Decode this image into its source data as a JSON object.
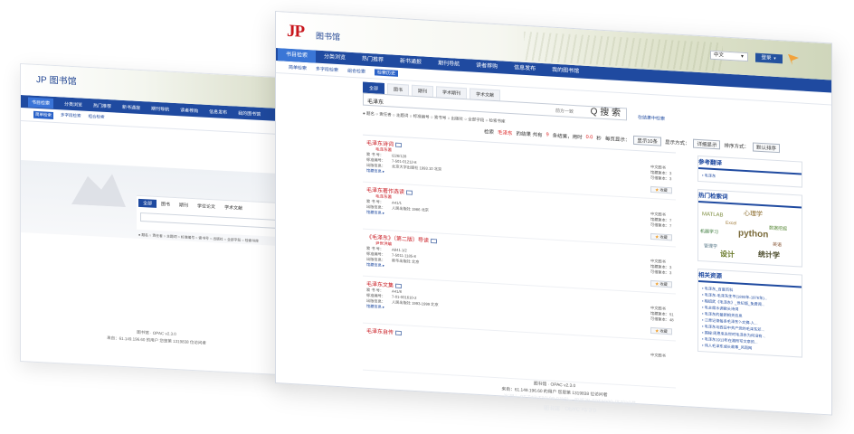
{
  "back_window": {
    "logo": "JP",
    "logo_text": "图书馆",
    "nav": [
      "书目检索",
      "分类浏览",
      "热门推荐",
      "新书通报",
      "期刊导航",
      "读者荐购",
      "信息发布",
      "我的图书馆"
    ],
    "subnav": [
      "简单检索",
      "多字段检索",
      "组合检索"
    ],
    "search_tabs": [
      "全部",
      "图书",
      "期刊",
      "学位论文",
      "学术文献"
    ],
    "options_line": "● 题名 ○ 责任者 ○ 主题词 ○ 标准编号 ○ 索书号 ○ 出版社 ○ 全部字段 ○ 检索书库",
    "footer_line1": "图书馆 · OPAC v2.3.0",
    "footer_line2": "来自：61.149.196.60 的用户 您是第 1319838 位访问者"
  },
  "front_window": {
    "logo": "JP",
    "logo_text": "图书馆",
    "lang_select": "中文",
    "login_button": "登录",
    "nav": [
      "书目检索",
      "分类浏览",
      "热门推荐",
      "新书通报",
      "期刊导航",
      "读者荐购",
      "信息发布",
      "我的图书馆"
    ],
    "subnav": [
      "简单检索",
      "多字段检索",
      "组合检索",
      "检索历史"
    ],
    "search": {
      "tabs": [
        "全部",
        "图书",
        "期刊",
        "学术期刊",
        "学术文献"
      ],
      "query": "毛泽东",
      "scope": "前方一致",
      "button": "Q 搜 索",
      "advanced": "在结果中检索",
      "options": "● 题名 ○ 责任者 ○ 主题词 ○ 标准编号 ○ 索书号 ○ 出版社 ○ 全部字段 ○ 检索书库"
    },
    "result_bar": {
      "label": "检索",
      "query": "毛泽东",
      "found_pre": "的结果 共有",
      "count": "9",
      "found_post": "条结果，用时",
      "time": "0.0",
      "time_unit": "秒",
      "per_page_label": "每页显示：",
      "per_page": "显示10条",
      "display_label": "显示方式：",
      "display": "详细显示",
      "sort_label": "排序方式：",
      "sort": "默认排序"
    },
    "records": [
      {
        "title": "毛泽东诗词",
        "author": "毛泽东著",
        "call_no": "I226/128",
        "isbn": "7-501-01212-8",
        "publisher": "北京大学出版社  1993.10  北京",
        "type": "中文图书",
        "holdings": "馆藏复本：3",
        "available": "可借复本：3"
      },
      {
        "title": "毛泽东著作选读",
        "author": "毛泽东著",
        "call_no": "A41/1",
        "isbn": "",
        "publisher": "人民出版社  1986  北京",
        "type": "中文图书",
        "holdings": "馆藏复本：7",
        "available": "可借复本：7"
      },
      {
        "title": "《毛泽东》（第二版）导读",
        "author": "尹世洪编",
        "call_no": "A841.1/2",
        "isbn": "7-5011-1185-8",
        "publisher": "新华出版社  北京",
        "type": "中文图书",
        "holdings": "馆藏复本：3",
        "available": "可借复本：3"
      },
      {
        "title": "毛泽东文集",
        "author": "",
        "call_no": "A41/8",
        "isbn": "7-01-001610-2",
        "publisher": "人民出版社  1993-1999  北京",
        "type": "中文图书",
        "holdings": "馆藏复本：51",
        "available": "可借复本：48"
      },
      {
        "title": "毛泽东自传",
        "author": "",
        "call_no": "",
        "isbn": "",
        "publisher": "",
        "type": "中文图书",
        "holdings": "",
        "available": ""
      }
    ],
    "record_labels": {
      "call_no": "索 书 号：",
      "isbn": "标准编号：",
      "publisher": "出版信息：",
      "more": "馆藏信息 ▸",
      "fav": "收藏"
    },
    "sidebar": {
      "ref_title": "参考翻译",
      "ref_items": [
        "• 毛泽东"
      ],
      "hot_title": "热门检索词",
      "cloud": [
        "MATLAB",
        "心理学",
        "Excel",
        "python",
        "数据挖掘",
        "机器学习",
        "管理学",
        "设计",
        "统计学",
        "英语"
      ],
      "related_title": "相关资源",
      "related_items": [
        "• 毛泽东_百度百科",
        "• 毛泽东-毛泽东生平(1893年-1976年)...",
        "• 梅绍武《毛泽东》_世纪版_免费阅...",
        "• 毛主席水调歌头诗词",
        "• 毛泽东的最新相关信息",
        "• 江青记录每条毛泽东?-文摘-人...",
        "• 毛泽东与西日中共产党的毛泽东邓...",
        "• 揭秘:周恩来去世时毛泽东为何没有...",
        "• 毛泽东1913年在湘所写文章的...",
        "• 伟人毛泽东成长故事_风雨网"
      ]
    },
    "footer_line1": "图书馆 · OPAC v2.3.0",
    "footer_line2": "来自：61.149.196.60 的用户 您是第 1319838 位访问者"
  },
  "reflection_line1": "图书馆 · OPAC v2.3.0",
  "reflection_line2": "来自：61.149.196.60 的用户 您是第 1319838 位访问者",
  "colors": {
    "nav": "#1f4aa0",
    "accent_red": "#c8161d",
    "fav": "#f09a1e"
  }
}
